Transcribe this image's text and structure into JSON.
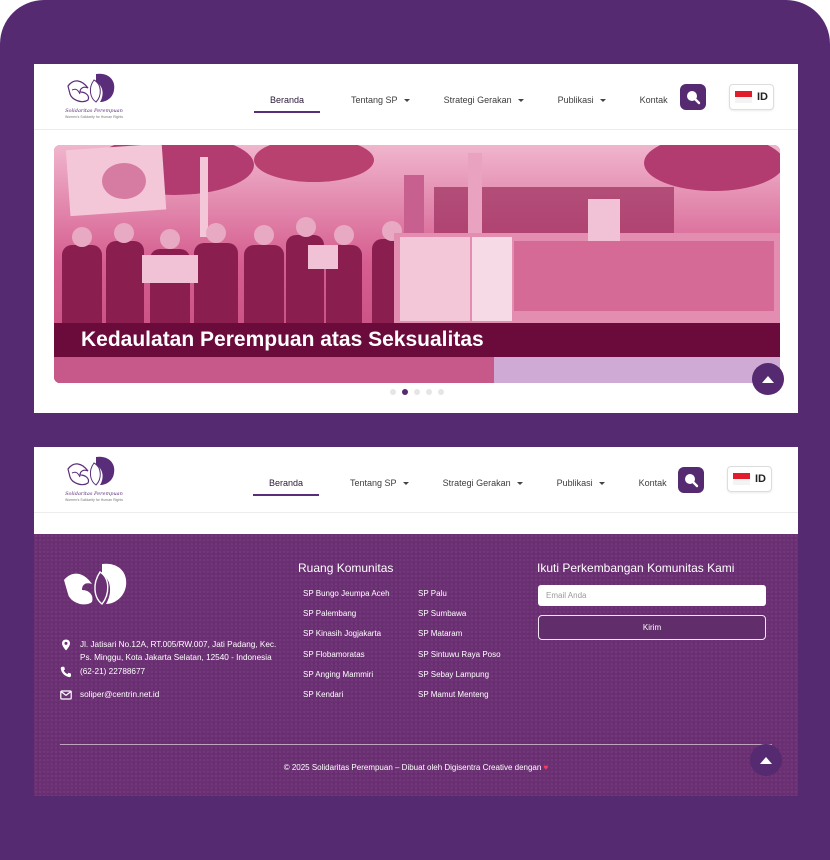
{
  "colors": {
    "frame": "#552a71",
    "primary": "#552a71",
    "caption_bg": "#6a0b3b",
    "footer_bg": "#6b2f73",
    "slide_tint": "#d04f84",
    "heart": "#ff3b5c"
  },
  "brand": {
    "name": "Solidaritas Perempuan",
    "tagline": "Women's Solidarity for Human Rights"
  },
  "nav": {
    "items": [
      {
        "label": "Beranda",
        "active": true,
        "dropdown": false
      },
      {
        "label": "Tentang SP",
        "active": false,
        "dropdown": true
      },
      {
        "label": "Strategi Gerakan",
        "active": false,
        "dropdown": true
      },
      {
        "label": "Publikasi",
        "active": false,
        "dropdown": true
      },
      {
        "label": "Kontak",
        "active": false,
        "dropdown": false
      }
    ],
    "search_icon": "search-icon",
    "language": "ID"
  },
  "hero": {
    "caption": "Kedaulatan Perempuan atas Seksualitas",
    "slide_count": 5,
    "active_slide": 2
  },
  "footer": {
    "address": "Jl. Jatisari No.12A, RT.005/RW.007, Jati Padang, Kec. Ps. Minggu, Kota Jakarta Selatan, 12540 - Indonesia",
    "phone": "(62-21) 22788677",
    "email": "soliper@centrin.net.id",
    "community_title": "Ruang Komunitas",
    "communities_left": [
      "SP Bungo Jeumpa Aceh",
      "SP Palembang",
      "SP Kinasih Jogjakarta",
      "SP Flobamoratas",
      "SP Anging Mammiri",
      "SP Kendari"
    ],
    "communities_right": [
      "SP Palu",
      "SP Sumbawa",
      "SP Mataram",
      "SP Sintuwu Raya Poso",
      "SP Sebay Lampung",
      "SP Mamut Menteng"
    ],
    "newsletter_title": "Ikuti Perkembangan Komunitas Kami",
    "email_placeholder": "Email Anda",
    "submit_label": "Kirim",
    "copyright": "© 2025 Solidaritas Perempuan – Dibuat oleh Digisentra Creative dengan",
    "heart": "♥"
  }
}
